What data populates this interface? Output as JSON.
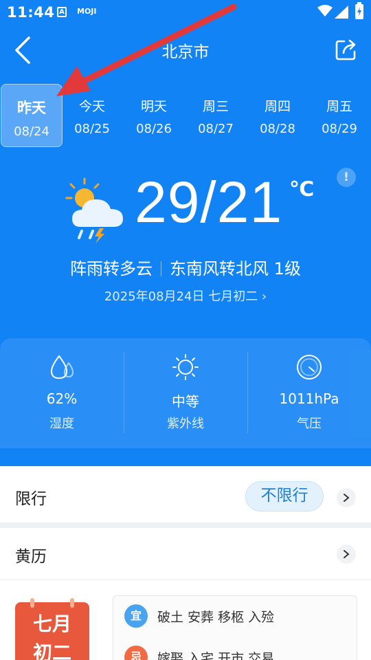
{
  "status_bar": {
    "time": "11:44",
    "app_badge": "A",
    "app_label": "MOJI"
  },
  "header": {
    "city": "北京市"
  },
  "date_tabs": [
    {
      "day": "昨天",
      "date": "08/24",
      "active": true
    },
    {
      "day": "今天",
      "date": "08/25"
    },
    {
      "day": "明天",
      "date": "08/26"
    },
    {
      "day": "周三",
      "date": "08/27"
    },
    {
      "day": "周四",
      "date": "08/28"
    },
    {
      "day": "周五",
      "date": "08/29"
    }
  ],
  "current": {
    "icon": "thunder-shower-icon",
    "temperature": "29/21",
    "unit": "℃",
    "condition": "阵雨转多云",
    "wind": "东南风转北风 1级",
    "date_line": "2025年08月24日 七月初二 ›",
    "info_glyph": "!"
  },
  "stats": [
    {
      "icon": "humidity-icon",
      "value": "62%",
      "label": "湿度"
    },
    {
      "icon": "sun-icon",
      "value": "中等",
      "label": "紫外线"
    },
    {
      "icon": "gauge-icon",
      "value": "1011hPa",
      "label": "气压"
    }
  ],
  "traffic": {
    "title": "限行",
    "status": "不限行"
  },
  "almanac": {
    "title": "黄历",
    "calendar_line1": "七月",
    "calendar_line2": "初二",
    "rows": [
      {
        "badge": "宜",
        "text": "破土 安葬 移柩 入殓"
      },
      {
        "badge": "忌",
        "text": "嫁娶 入宅 开市 交易"
      }
    ]
  },
  "colors": {
    "primary": "#1183f5",
    "annotation_arrow": "#e23a3a",
    "accent_yi": "#4aa3ee",
    "accent_ji": "#f06b44"
  }
}
